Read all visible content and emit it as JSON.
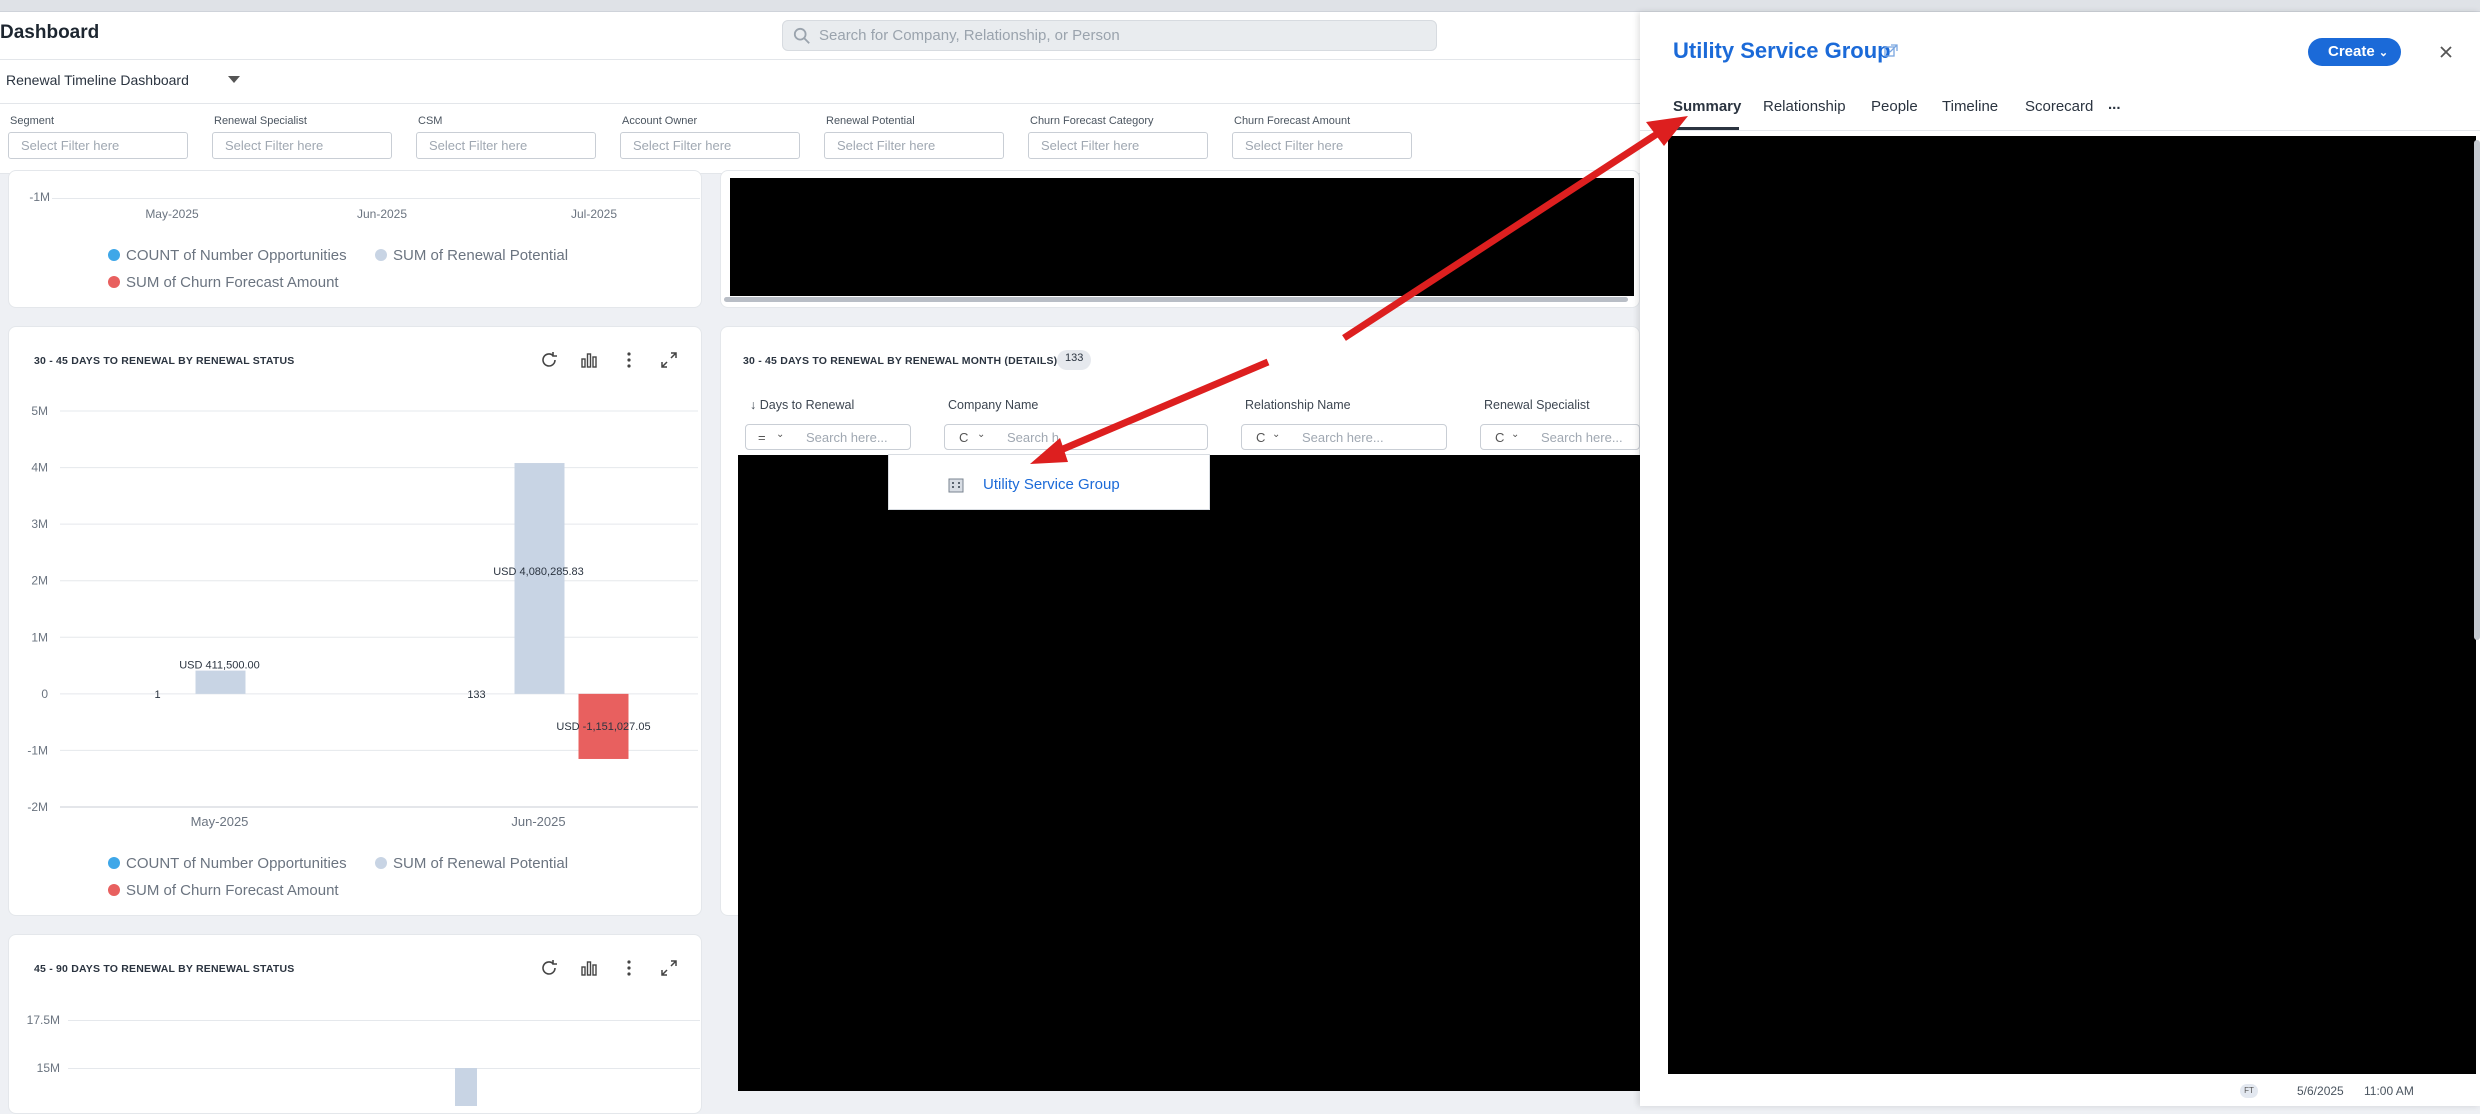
{
  "header": {
    "title": "Dashboard",
    "search_placeholder": "Search for Company, Relationship, or Person"
  },
  "dashboard_selector": {
    "value": "Renewal Timeline Dashboard"
  },
  "filters": [
    {
      "label": "Segment",
      "placeholder": "Select Filter here"
    },
    {
      "label": "Renewal Specialist",
      "placeholder": "Select Filter here"
    },
    {
      "label": "CSM",
      "placeholder": "Select Filter here"
    },
    {
      "label": "Account Owner",
      "placeholder": "Select Filter here"
    },
    {
      "label": "Renewal Potential",
      "placeholder": "Select Filter here"
    },
    {
      "label": "Churn Forecast Category",
      "placeholder": "Select Filter here"
    },
    {
      "label": "Churn Forecast Amount",
      "placeholder": "Select Filter here"
    }
  ],
  "top_chart": {
    "y_tick": "-1M",
    "x_ticks": [
      "May-2025",
      "Jun-2025",
      "Jul-2025"
    ],
    "legend": [
      "COUNT of Number Opportunities",
      "SUM of Renewal Potential",
      "SUM of Churn Forecast Amount"
    ]
  },
  "colors": {
    "count": "#3fa7e8",
    "renewal": "#c8d4e4",
    "churn": "#e8605f",
    "accent": "#1b6ad8",
    "arrow": "#dd1f1f"
  },
  "chart_data": [
    {
      "type": "bar",
      "title": "30 - 45 DAYS TO RENEWAL BY RENEWAL STATUS",
      "categories": [
        "May-2025",
        "Jun-2025"
      ],
      "series": [
        {
          "name": "COUNT of Number Opportunities",
          "values": [
            1,
            133
          ]
        },
        {
          "name": "SUM of Renewal Potential",
          "values": [
            411500.0,
            4080285.83
          ]
        },
        {
          "name": "SUM of Churn Forecast Amount",
          "values": [
            0,
            -1151027.05
          ]
        }
      ],
      "y_ticks": [
        "5M",
        "4M",
        "3M",
        "2M",
        "1M",
        "0",
        "-1M",
        "-2M"
      ],
      "ylim": [
        -2000000,
        5000000
      ],
      "data_labels": {
        "count": [
          "1",
          "133"
        ],
        "renewal": [
          "USD 411,500.00",
          "USD 4,080,285.83"
        ],
        "churn": [
          "",
          "USD -1,151,027.05"
        ]
      },
      "legend": "bottom"
    },
    {
      "type": "bar",
      "title": "45 - 90 DAYS TO RENEWAL BY RENEWAL STATUS",
      "y_ticks": [
        "17.5M",
        "15M"
      ]
    }
  ],
  "details_table": {
    "title": "30 - 45 DAYS TO RENEWAL BY RENEWAL MONTH (DETAILS)",
    "count": "133",
    "columns": [
      {
        "label": "Days to Renewal",
        "sort": "↓",
        "filter_op": "=",
        "placeholder": "Search here..."
      },
      {
        "label": "Company Name",
        "filter_op": "C",
        "placeholder": "Search h",
        "value": ""
      },
      {
        "label": "Relationship Name",
        "filter_op": "C",
        "placeholder": "Search here..."
      },
      {
        "label": "Renewal Specialist",
        "filter_op": "C",
        "placeholder": "Search here..."
      }
    ],
    "dropdown_option": "Utility Service Group"
  },
  "panel": {
    "title": "Utility Service Group",
    "create_label": "Create",
    "tabs": [
      "Summary",
      "Relationship",
      "People",
      "Timeline",
      "Scorecard",
      "..."
    ],
    "footer": {
      "avatar": "FT",
      "date": "5/6/2025",
      "time": "11:00 AM"
    }
  }
}
